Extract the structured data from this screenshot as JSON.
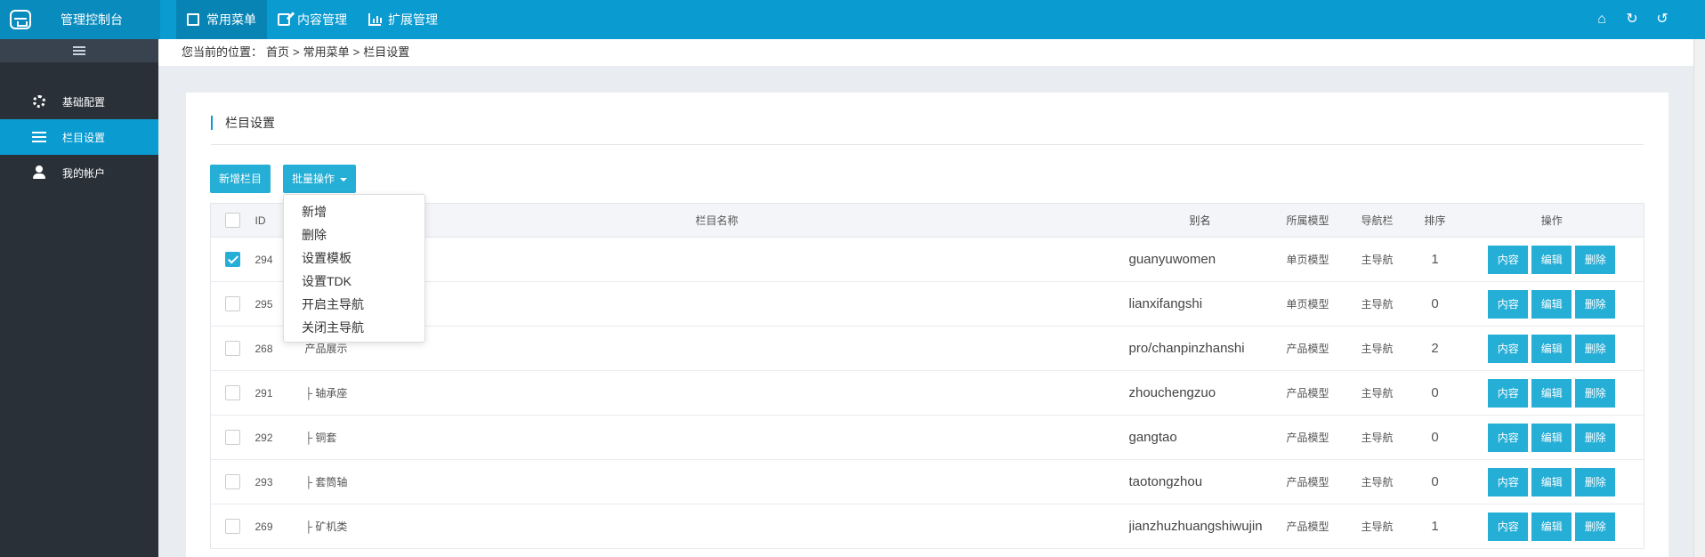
{
  "topbar": {
    "title": "管理控制台",
    "nav": [
      "常用菜单",
      "内容管理",
      "扩展管理"
    ],
    "right_icons": [
      "home-icon",
      "refresh-icon",
      "undo-icon"
    ]
  },
  "sidebar": {
    "items": [
      "基础配置",
      "栏目设置",
      "我的帐户"
    ],
    "active": "栏目设置"
  },
  "breadcrumb": {
    "prefix": "您当前的位置：",
    "parts": [
      "首页",
      ">",
      "常用菜单",
      ">",
      "栏目设置"
    ]
  },
  "panel": {
    "title": "栏目设置",
    "add_button": "新增栏目",
    "batch_button": "批量操作"
  },
  "dropdown": {
    "items": [
      "新增",
      "删除",
      "设置模板",
      "设置TDK",
      "开启主导航",
      "关闭主导航"
    ]
  },
  "table": {
    "headers": [
      "ID",
      "栏目名称",
      "别名",
      "所属模型",
      "导航栏",
      "排序",
      "操作"
    ],
    "rows": [
      {
        "checked": true,
        "id": "294",
        "name": "",
        "alias": "guanyuwomen",
        "model": "单页模型",
        "nav": "主导航",
        "sort": "1"
      },
      {
        "checked": false,
        "id": "295",
        "name": "",
        "alias": "lianxifangshi",
        "model": "单页模型",
        "nav": "主导航",
        "sort": "0"
      },
      {
        "checked": false,
        "id": "268",
        "name": "产品展示",
        "alias": "pro/chanpinzhanshi",
        "model": "产品模型",
        "nav": "主导航",
        "sort": "2"
      },
      {
        "checked": false,
        "id": "291",
        "name": "├ 轴承座",
        "alias": "zhouchengzuo",
        "model": "产品模型",
        "nav": "主导航",
        "sort": "0"
      },
      {
        "checked": false,
        "id": "292",
        "name": "├ 铜套",
        "alias": "gangtao",
        "model": "产品模型",
        "nav": "主导航",
        "sort": "0"
      },
      {
        "checked": false,
        "id": "293",
        "name": "├ 套筒轴",
        "alias": "taotongzhou",
        "model": "产品模型",
        "nav": "主导航",
        "sort": "0"
      },
      {
        "checked": false,
        "id": "269",
        "name": "├ 矿机类",
        "alias": "jianzhuzhuangshiwujin",
        "model": "产品模型",
        "nav": "主导航",
        "sort": "1"
      }
    ],
    "op_labels": [
      "内容",
      "编辑",
      "删除"
    ]
  }
}
